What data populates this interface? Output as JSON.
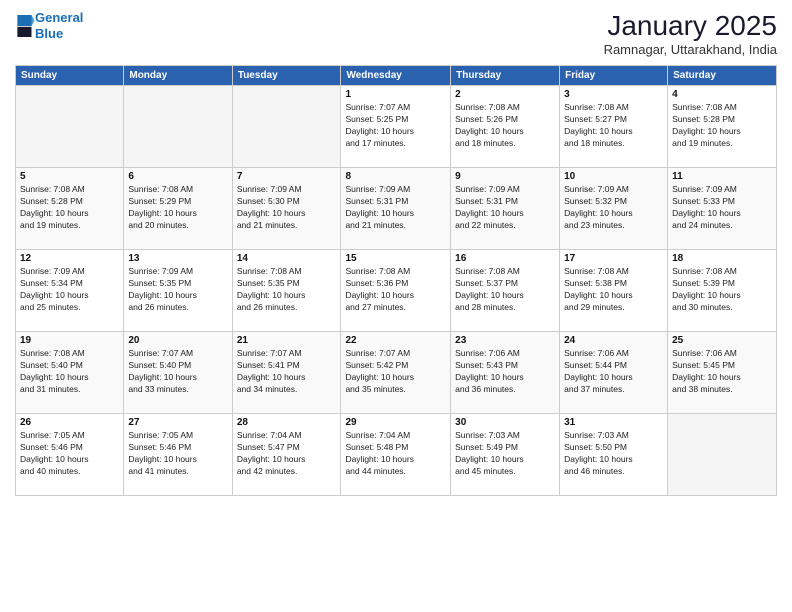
{
  "logo": {
    "line1": "General",
    "line2": "Blue"
  },
  "title": "January 2025",
  "subtitle": "Ramnagar, Uttarakhand, India",
  "days_header": [
    "Sunday",
    "Monday",
    "Tuesday",
    "Wednesday",
    "Thursday",
    "Friday",
    "Saturday"
  ],
  "weeks": [
    [
      {
        "num": "",
        "info": ""
      },
      {
        "num": "",
        "info": ""
      },
      {
        "num": "",
        "info": ""
      },
      {
        "num": "1",
        "info": "Sunrise: 7:07 AM\nSunset: 5:25 PM\nDaylight: 10 hours\nand 17 minutes."
      },
      {
        "num": "2",
        "info": "Sunrise: 7:08 AM\nSunset: 5:26 PM\nDaylight: 10 hours\nand 18 minutes."
      },
      {
        "num": "3",
        "info": "Sunrise: 7:08 AM\nSunset: 5:27 PM\nDaylight: 10 hours\nand 18 minutes."
      },
      {
        "num": "4",
        "info": "Sunrise: 7:08 AM\nSunset: 5:28 PM\nDaylight: 10 hours\nand 19 minutes."
      }
    ],
    [
      {
        "num": "5",
        "info": "Sunrise: 7:08 AM\nSunset: 5:28 PM\nDaylight: 10 hours\nand 19 minutes."
      },
      {
        "num": "6",
        "info": "Sunrise: 7:08 AM\nSunset: 5:29 PM\nDaylight: 10 hours\nand 20 minutes."
      },
      {
        "num": "7",
        "info": "Sunrise: 7:09 AM\nSunset: 5:30 PM\nDaylight: 10 hours\nand 21 minutes."
      },
      {
        "num": "8",
        "info": "Sunrise: 7:09 AM\nSunset: 5:31 PM\nDaylight: 10 hours\nand 21 minutes."
      },
      {
        "num": "9",
        "info": "Sunrise: 7:09 AM\nSunset: 5:31 PM\nDaylight: 10 hours\nand 22 minutes."
      },
      {
        "num": "10",
        "info": "Sunrise: 7:09 AM\nSunset: 5:32 PM\nDaylight: 10 hours\nand 23 minutes."
      },
      {
        "num": "11",
        "info": "Sunrise: 7:09 AM\nSunset: 5:33 PM\nDaylight: 10 hours\nand 24 minutes."
      }
    ],
    [
      {
        "num": "12",
        "info": "Sunrise: 7:09 AM\nSunset: 5:34 PM\nDaylight: 10 hours\nand 25 minutes."
      },
      {
        "num": "13",
        "info": "Sunrise: 7:09 AM\nSunset: 5:35 PM\nDaylight: 10 hours\nand 26 minutes."
      },
      {
        "num": "14",
        "info": "Sunrise: 7:08 AM\nSunset: 5:35 PM\nDaylight: 10 hours\nand 26 minutes."
      },
      {
        "num": "15",
        "info": "Sunrise: 7:08 AM\nSunset: 5:36 PM\nDaylight: 10 hours\nand 27 minutes."
      },
      {
        "num": "16",
        "info": "Sunrise: 7:08 AM\nSunset: 5:37 PM\nDaylight: 10 hours\nand 28 minutes."
      },
      {
        "num": "17",
        "info": "Sunrise: 7:08 AM\nSunset: 5:38 PM\nDaylight: 10 hours\nand 29 minutes."
      },
      {
        "num": "18",
        "info": "Sunrise: 7:08 AM\nSunset: 5:39 PM\nDaylight: 10 hours\nand 30 minutes."
      }
    ],
    [
      {
        "num": "19",
        "info": "Sunrise: 7:08 AM\nSunset: 5:40 PM\nDaylight: 10 hours\nand 31 minutes."
      },
      {
        "num": "20",
        "info": "Sunrise: 7:07 AM\nSunset: 5:40 PM\nDaylight: 10 hours\nand 33 minutes."
      },
      {
        "num": "21",
        "info": "Sunrise: 7:07 AM\nSunset: 5:41 PM\nDaylight: 10 hours\nand 34 minutes."
      },
      {
        "num": "22",
        "info": "Sunrise: 7:07 AM\nSunset: 5:42 PM\nDaylight: 10 hours\nand 35 minutes."
      },
      {
        "num": "23",
        "info": "Sunrise: 7:06 AM\nSunset: 5:43 PM\nDaylight: 10 hours\nand 36 minutes."
      },
      {
        "num": "24",
        "info": "Sunrise: 7:06 AM\nSunset: 5:44 PM\nDaylight: 10 hours\nand 37 minutes."
      },
      {
        "num": "25",
        "info": "Sunrise: 7:06 AM\nSunset: 5:45 PM\nDaylight: 10 hours\nand 38 minutes."
      }
    ],
    [
      {
        "num": "26",
        "info": "Sunrise: 7:05 AM\nSunset: 5:46 PM\nDaylight: 10 hours\nand 40 minutes."
      },
      {
        "num": "27",
        "info": "Sunrise: 7:05 AM\nSunset: 5:46 PM\nDaylight: 10 hours\nand 41 minutes."
      },
      {
        "num": "28",
        "info": "Sunrise: 7:04 AM\nSunset: 5:47 PM\nDaylight: 10 hours\nand 42 minutes."
      },
      {
        "num": "29",
        "info": "Sunrise: 7:04 AM\nSunset: 5:48 PM\nDaylight: 10 hours\nand 44 minutes."
      },
      {
        "num": "30",
        "info": "Sunrise: 7:03 AM\nSunset: 5:49 PM\nDaylight: 10 hours\nand 45 minutes."
      },
      {
        "num": "31",
        "info": "Sunrise: 7:03 AM\nSunset: 5:50 PM\nDaylight: 10 hours\nand 46 minutes."
      },
      {
        "num": "",
        "info": ""
      }
    ]
  ]
}
